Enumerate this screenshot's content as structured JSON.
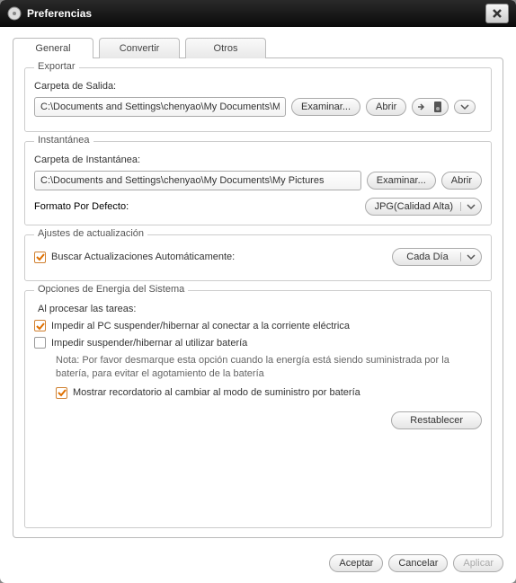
{
  "window": {
    "title": "Preferencias"
  },
  "tabs": {
    "general": "General",
    "convert": "Convertir",
    "others": "Otros"
  },
  "export": {
    "section": "Exportar",
    "folder_label": "Carpeta de Salida:",
    "folder_value": "C:\\Documents and Settings\\chenyao\\My Documents\\My Vide",
    "browse": "Examinar...",
    "open": "Abrir"
  },
  "snapshot": {
    "section": "Instantánea",
    "folder_label": "Carpeta de Instantánea:",
    "folder_value": "C:\\Documents and Settings\\chenyao\\My Documents\\My Pictures",
    "browse": "Examinar...",
    "open": "Abrir",
    "format_label": "Formato Por Defecto:",
    "format_value": "JPG(Calidad Alta)"
  },
  "updates": {
    "section": "Ajustes de actualización",
    "auto_label": "Buscar Actualizaciones Automáticamente:",
    "freq_value": "Cada Día"
  },
  "energy": {
    "section": "Opciones de Energia del Sistema",
    "processing": "Al procesar las tareas:",
    "prevent_ac": "Impedir al PC suspender/hibernar al conectar a la corriente eléctrica",
    "prevent_battery": "Impedir  suspender/hibernar al utilizar batería",
    "note": "Nota: Por favor desmarque esta opción cuando la energía está siendo suministrada por la batería, para evitar el agotamiento de la batería",
    "show_reminder": "Mostrar recordatorio al cambiar al modo de suministro por batería"
  },
  "buttons": {
    "restore": "Restablecer",
    "ok": "Aceptar",
    "cancel": "Cancelar",
    "apply": "Aplicar"
  }
}
